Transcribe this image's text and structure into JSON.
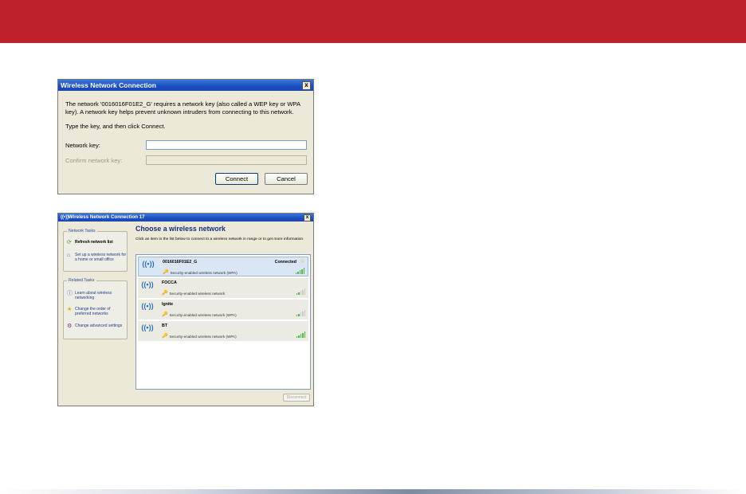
{
  "colors": {
    "banner": "#c0202d",
    "xp_title": "#1a4fbf",
    "dialog_bg": "#ece9d8"
  },
  "dialog1": {
    "title": "Wireless Network Connection",
    "close": "x",
    "message": "The network '0016016F01E2_G' requires a network key (also called a WEP key or WPA key). A network key helps prevent unknown intruders from connecting to this network.",
    "instruction": "Type the key, and then click Connect.",
    "network_key_label": "Network key:",
    "confirm_key_label": "Confirm network key:",
    "connect_label": "Connect",
    "cancel_label": "Cancel"
  },
  "dialog2": {
    "title": "Wireless Network Connection 17",
    "close": "x",
    "network_tasks": {
      "title": "Network Tasks",
      "items": [
        {
          "label": "Refresh network list",
          "icon": "refresh-icon"
        },
        {
          "label": "Set up a wireless network for a home or small office",
          "icon": "setup-network-icon"
        }
      ]
    },
    "related_tasks": {
      "title": "Related Tasks",
      "items": [
        {
          "label": "Learn about wireless networking",
          "icon": "info-icon"
        },
        {
          "label": "Change the order of preferred networks",
          "icon": "star-icon"
        },
        {
          "label": "Change advanced settings",
          "icon": "settings-icon"
        }
      ]
    },
    "heading": "Choose a wireless network",
    "intro": "Click an item in the list below to connect to a wireless network in range or to get more information.",
    "networks": [
      {
        "name": "0016016F01E2_G",
        "status": "Connected",
        "security": "Security-enabled wireless network (WPA)",
        "signal": 5
      },
      {
        "name": "FOCCA",
        "status": "",
        "security": "Security-enabled wireless network",
        "signal": 2
      },
      {
        "name": "Ignite",
        "status": "",
        "security": "Security-enabled wireless network (WPA)",
        "signal": 2
      },
      {
        "name": "BT",
        "status": "",
        "security": "Security-enabled wireless network (WPA)",
        "signal": 5
      }
    ],
    "disconnect_label": "Disconnect"
  }
}
